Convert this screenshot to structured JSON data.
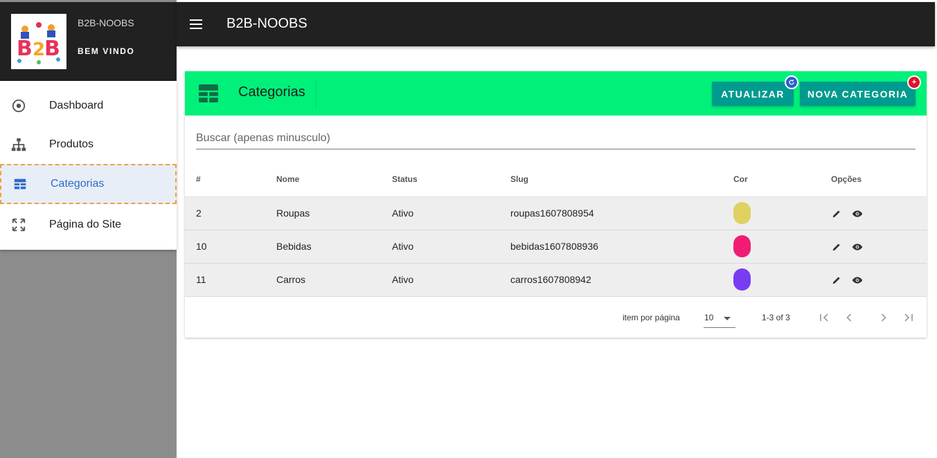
{
  "sidebar": {
    "brand": "B2B-NOOBS",
    "welcome": "BEM VINDO",
    "items": [
      {
        "label": "Dashboard",
        "icon": "radio-target-icon"
      },
      {
        "label": "Produtos",
        "icon": "sitemap-icon"
      },
      {
        "label": "Categorias",
        "icon": "table-icon",
        "active": true
      },
      {
        "label": "Página do Site",
        "icon": "fullscreen-icon"
      }
    ]
  },
  "topbar": {
    "title": "B2B-NOOBS"
  },
  "card": {
    "title": "Categorias",
    "refresh_label": "ATUALIZAR",
    "new_label": "NOVA CATEGORIA",
    "new_badge": "+"
  },
  "search": {
    "placeholder": "Buscar (apenas minusculo)"
  },
  "table": {
    "headers": [
      "#",
      "Nome",
      "Status",
      "Slug",
      "Cor",
      "Opções"
    ],
    "rows": [
      {
        "id": "2",
        "nome": "Roupas",
        "status": "Ativo",
        "slug": "roupas1607808954",
        "cor": "#e0d060"
      },
      {
        "id": "10",
        "nome": "Bebidas",
        "status": "Ativo",
        "slug": "bebidas1607808936",
        "cor": "#f01c74"
      },
      {
        "id": "11",
        "nome": "Carros",
        "status": "Ativo",
        "slug": "carros1607808942",
        "cor": "#7a3cf0"
      }
    ]
  },
  "pagination": {
    "label": "item por página",
    "per_page": "10",
    "range": "1-3 of 3"
  },
  "colors": {
    "header_dark": "#212121",
    "card_header": "#00f07a",
    "button": "#009b8f",
    "active_nav": "#2e6bc6"
  }
}
